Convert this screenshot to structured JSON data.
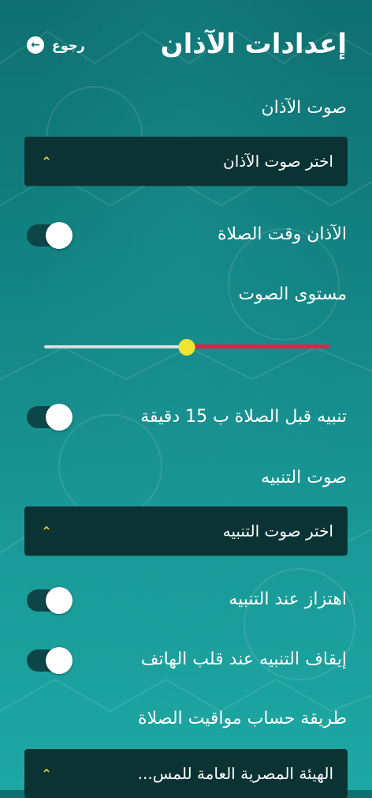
{
  "header": {
    "title": "إعدادات الآذان",
    "back_label": "رجوع",
    "back_icon": "arrow-left-circle-icon"
  },
  "adhan_sound": {
    "label": "صوت الآذان",
    "select_value": "اختر صوت الآذان",
    "caret_icon": "chevron-up-icon"
  },
  "adhan_at_prayer": {
    "label": "الآذان وقت الصلاة",
    "enabled": true
  },
  "volume": {
    "label": "مستوى الصوت",
    "level": 0.5
  },
  "alert_before": {
    "label": "تنبيه قبل الصلاة ب 15 دقيقة",
    "enabled": true
  },
  "alert_sound": {
    "label": "صوت التنبيه",
    "select_value": "اختر صوت التنبيه",
    "caret_icon": "chevron-up-icon"
  },
  "vibrate": {
    "label": "اهتزاز عند التنبيه",
    "enabled": true
  },
  "flip_to_stop": {
    "label": "إيقاف التنبيه عند قلب الهاتف",
    "enabled": true
  },
  "calculation_method": {
    "label": "طريقة حساب مواقيت الصلاة",
    "select_value": "الهيئة المصرية العامة للمس...",
    "caret_icon": "chevron-up-icon"
  },
  "colors": {
    "caret": "#f2d33a",
    "slider_active": "#e0224a",
    "slider_inactive": "#d5dfe0",
    "slider_thumb": "#f3e52f",
    "select_bg": "#0b3333",
    "toggle_track": "#0d4648"
  },
  "caret_glyph": "⌃",
  "back_glyph": "←"
}
